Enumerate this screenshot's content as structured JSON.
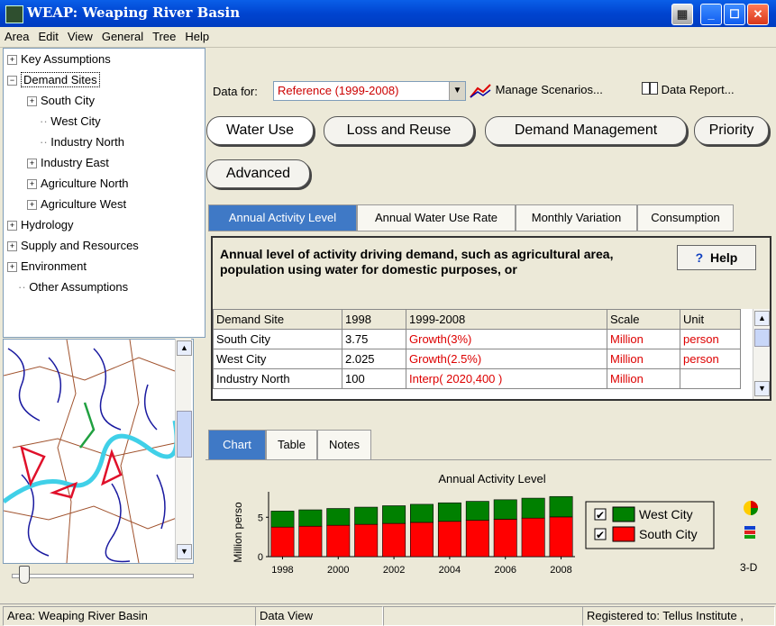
{
  "window": {
    "title": "WEAP: Weaping River Basin"
  },
  "menu": [
    "Area",
    "Edit",
    "View",
    "General",
    "Tree",
    "Help"
  ],
  "tree": [
    {
      "label": "Key Assumptions",
      "expander": "+"
    },
    {
      "label": "Demand Sites",
      "expander": "−"
    },
    {
      "label": "South City",
      "expander": "+"
    },
    {
      "label": "West City",
      "expander": ""
    },
    {
      "label": "Industry North",
      "expander": ""
    },
    {
      "label": "Industry East",
      "expander": "+"
    },
    {
      "label": "Agriculture North",
      "expander": "+"
    },
    {
      "label": "Agriculture West",
      "expander": "+"
    },
    {
      "label": "Hydrology",
      "expander": "+"
    },
    {
      "label": "Supply and Resources",
      "expander": "+"
    },
    {
      "label": "Environment",
      "expander": "+"
    },
    {
      "label": "Other Assumptions",
      "expander": ""
    }
  ],
  "toolbar": {
    "data_for_label": "Data for:",
    "scenario": "Reference (1999-2008)",
    "manage_scenarios": "Manage Scenarios...",
    "data_report": "Data Report..."
  },
  "category_buttons": [
    "Water Use",
    "Loss and Reuse",
    "Demand Management",
    "Priority",
    "Advanced"
  ],
  "tabs": [
    "Annual Activity Level",
    "Annual Water Use Rate",
    "Monthly Variation",
    "Consumption"
  ],
  "description": "Annual level of activity driving demand, such as agricultural area, population using water for domestic purposes, or",
  "help_label": "Help",
  "table": {
    "headers": [
      "Demand Site",
      "1998",
      "1999-2008",
      "Scale",
      "Unit"
    ],
    "rows": [
      [
        "South City",
        "3.75",
        "Growth(3%)",
        "Million",
        "person"
      ],
      [
        "West City",
        "2.025",
        "Growth(2.5%)",
        "Million",
        "person"
      ],
      [
        "Industry North",
        "100",
        "Interp( 2020,400 )",
        "Million",
        ""
      ]
    ]
  },
  "chart_tabs": [
    "Chart",
    "Table",
    "Notes"
  ],
  "chart_data": {
    "type": "bar",
    "title": "Annual Activity Level",
    "ylabel": "Million perso",
    "xlabel": "",
    "categories": [
      "1998",
      "1999",
      "2000",
      "2001",
      "2002",
      "2003",
      "2004",
      "2005",
      "2006",
      "2007",
      "2008"
    ],
    "x_tick_labels": [
      "1998",
      "2000",
      "2002",
      "2004",
      "2006",
      "2008"
    ],
    "y_ticks": [
      "0",
      "5"
    ],
    "ylim": [
      0,
      8
    ],
    "stacked": true,
    "series": [
      {
        "name": "South City",
        "color": "#ff0000",
        "values": [
          3.75,
          3.86,
          3.98,
          4.1,
          4.22,
          4.35,
          4.48,
          4.61,
          4.75,
          4.89,
          5.04
        ]
      },
      {
        "name": "West City",
        "color": "#008000",
        "values": [
          2.03,
          2.08,
          2.13,
          2.18,
          2.24,
          2.29,
          2.35,
          2.41,
          2.47,
          2.53,
          2.59
        ]
      }
    ],
    "legend": {
      "position": "right"
    }
  },
  "chart_side": {
    "label_3d": "3-D"
  },
  "status": {
    "area": "Area: Weaping River Basin",
    "view": "Data View",
    "registered": "Registered to: Tellus Institute ,"
  }
}
